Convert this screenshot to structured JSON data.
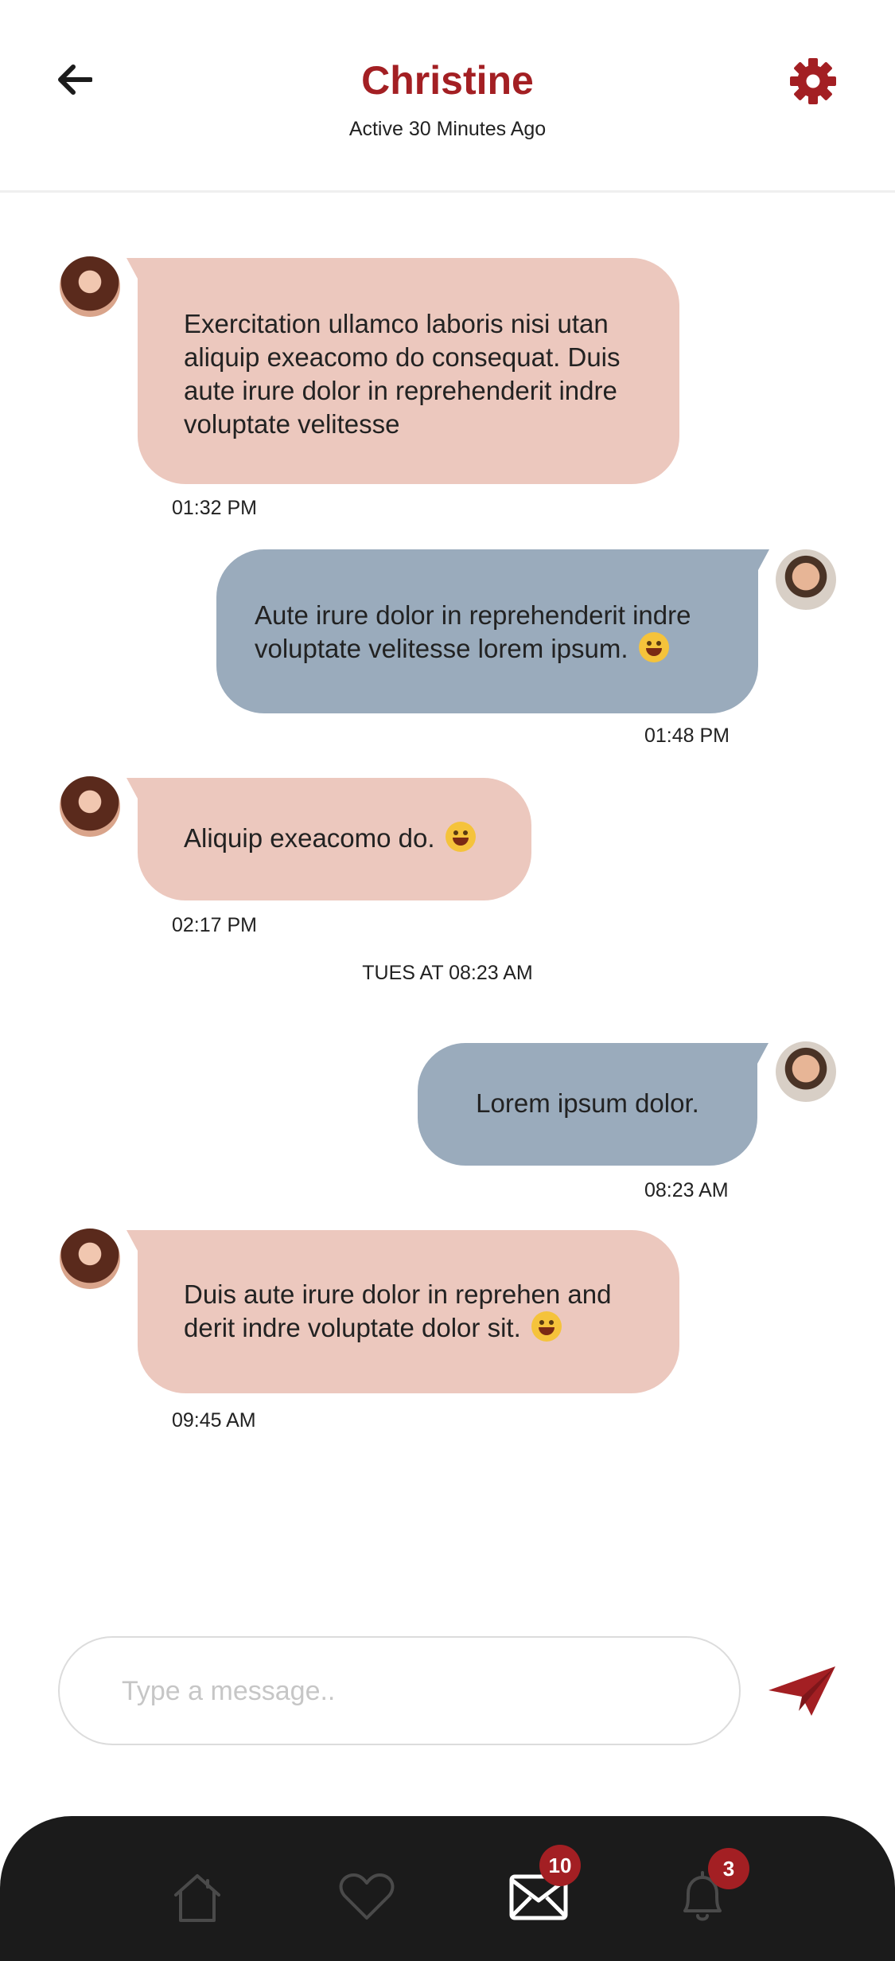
{
  "header": {
    "title": "Christine",
    "status": "Active 30 Minutes Ago",
    "back_icon": "arrow-left-icon",
    "settings_icon": "gear-icon",
    "accent_color": "#a31f23"
  },
  "messages": [
    {
      "direction": "incoming",
      "lines": [
        "Exercitation ullamco laboris nisi utan",
        "aliquip exeacomo do consequat. Duis",
        "aute irure dolor in reprehenderit indre",
        "voluptate velitesse"
      ],
      "time": "01:32 PM"
    },
    {
      "direction": "outgoing",
      "lines": [
        "Aute irure dolor in reprehenderit indre",
        "voluptate velitesse lorem ipsum."
      ],
      "emoji": "grinning-face-icon",
      "time": "01:48 PM"
    },
    {
      "direction": "incoming",
      "lines": [
        "Aliquip exeacomo do."
      ],
      "emoji": "smiling-face-icon",
      "time": "02:17 PM"
    },
    {
      "direction": "outgoing",
      "lines": [
        "Lorem ipsum dolor."
      ],
      "time": "08:23 AM"
    },
    {
      "direction": "incoming",
      "lines": [
        "Duis aute irure dolor in reprehen and",
        "derit indre voluptate dolor sit."
      ],
      "emoji": "laughing-face-icon",
      "time": "09:45 AM"
    }
  ],
  "day_separator": "TUES AT 08:23 AM",
  "composer": {
    "placeholder": "Type a message..",
    "value": "",
    "send_icon": "paper-plane-icon"
  },
  "bottom_nav": {
    "items": [
      {
        "icon": "home-icon",
        "active": false
      },
      {
        "icon": "heart-icon",
        "active": false
      },
      {
        "icon": "mail-icon",
        "active": true,
        "badge": "10"
      },
      {
        "icon": "bell-icon",
        "active": false,
        "badge": "3"
      }
    ]
  },
  "colors": {
    "incoming_bubble": "#ecc8be",
    "outgoing_bubble": "#9aabbc",
    "nav_background": "#1b1b1b",
    "badge": "#a31f23"
  }
}
